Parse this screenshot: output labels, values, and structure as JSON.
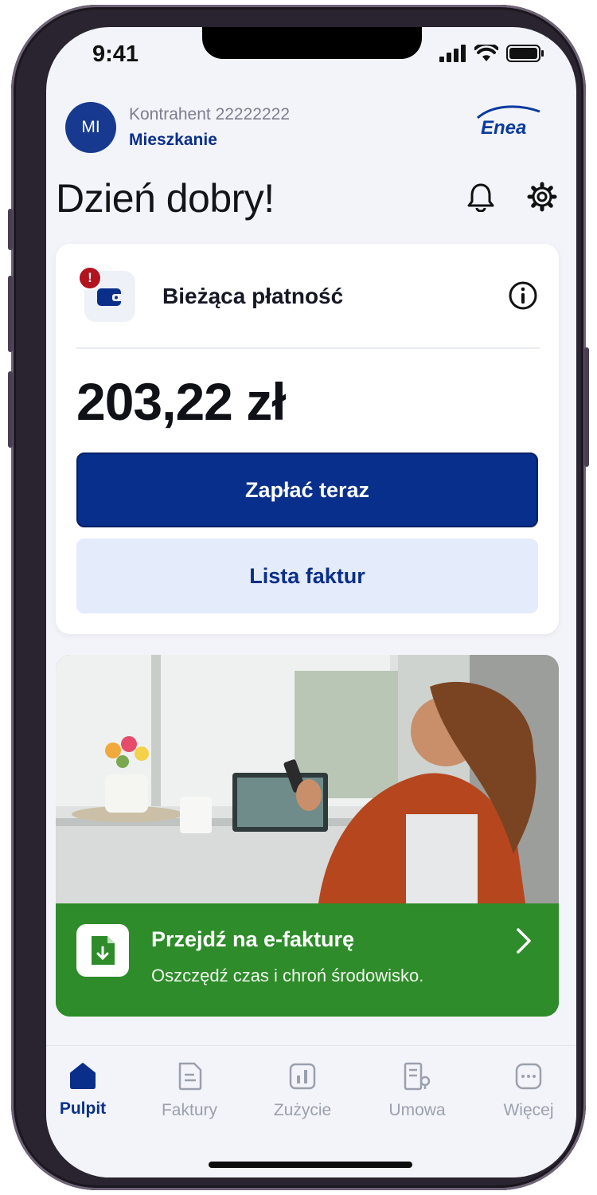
{
  "status_bar": {
    "time": "9:41"
  },
  "header": {
    "avatar_initials": "MI",
    "contractor_name": "Kontrahent 22222222",
    "place_name": "Mieszkanie",
    "logo_text": "Enea"
  },
  "greeting": "Dzień dobry!",
  "payment_card": {
    "title": "Bieżąca płatność",
    "alert_mark": "!",
    "amount": "203,22 zł",
    "pay_button": "Zapłać teraz",
    "invoices_button": "Lista faktur"
  },
  "promo": {
    "title": "Przejdź na e-fakturę",
    "subtitle": "Oszczędź czas i chroń środowisko."
  },
  "tabbar": {
    "items": [
      {
        "label": "Pulpit",
        "icon": "home-icon",
        "active": true
      },
      {
        "label": "Faktury",
        "icon": "invoice-icon",
        "active": false
      },
      {
        "label": "Zużycie",
        "icon": "usage-chart-icon",
        "active": false
      },
      {
        "label": "Umowa",
        "icon": "contract-icon",
        "active": false
      },
      {
        "label": "Więcej",
        "icon": "more-icon",
        "active": false
      }
    ]
  },
  "colors": {
    "brand_blue": "#082f8b",
    "light_blue": "#e4ebfa",
    "promo_green": "#2e8c2a",
    "alert_red": "#b3121f"
  }
}
